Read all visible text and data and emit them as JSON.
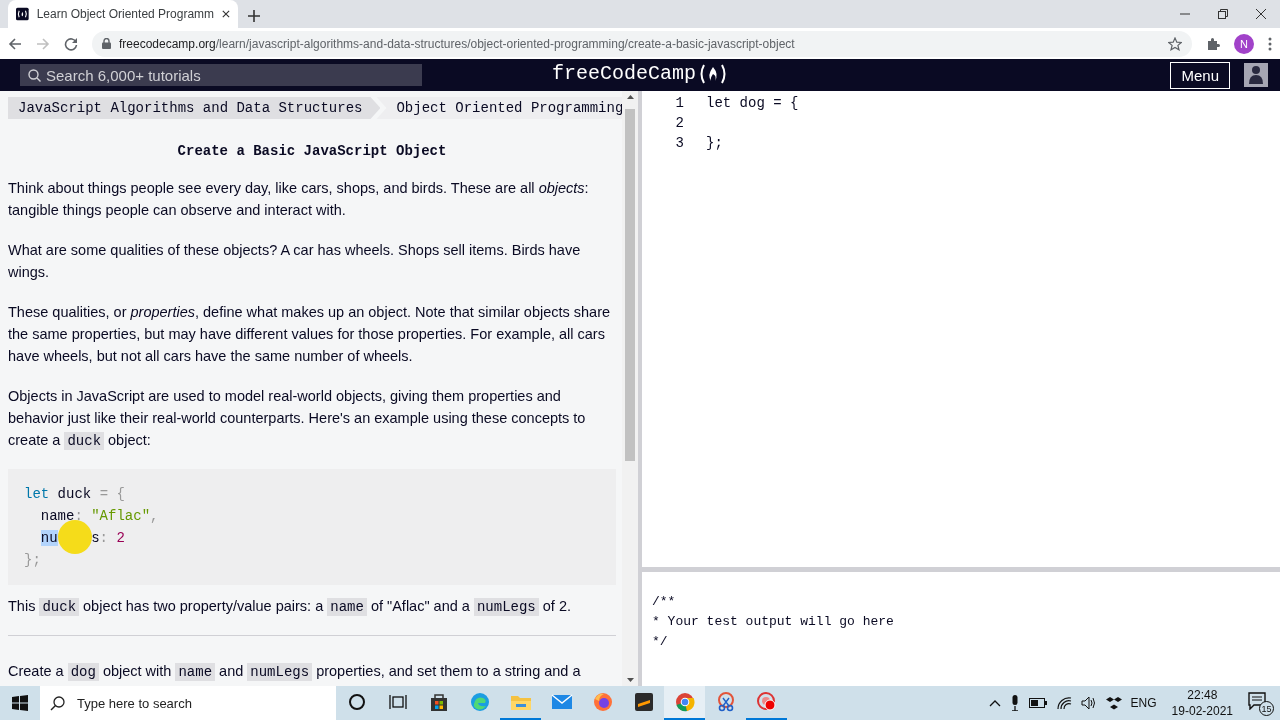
{
  "browser": {
    "tabs": [
      {
        "title": "Learn Object Oriented Programm",
        "selected": true
      }
    ],
    "url_host": "freecodecamp.org",
    "url_path": "/learn/javascript-algorithms-and-data-structures/object-oriented-programming/create-a-basic-javascript-object",
    "profile_initial": "N"
  },
  "nav": {
    "search_placeholder": "Search 6,000+ tutorials",
    "logo": "freeCodeCamp",
    "menu": "Menu"
  },
  "lesson": {
    "breadcrumbs": [
      "JavaScript Algorithms and Data Structures",
      "Object Oriented Programming"
    ],
    "title": "Create a Basic JavaScript Object",
    "intro": [
      [
        {
          "text": "Think about things people see every day, like cars, shops, and birds. These are all *objects*: tangible things people can observe and interact with."
        }
      ],
      [
        {
          "text": "What are some qualities of these objects? A car has wheels. Shops sell items. Birds have wings."
        }
      ],
      [
        {
          "text": "These qualities, or *properties*, define what makes up an object. Note that similar objects share the same properties, but may have different values for those properties. For example, all cars have wheels, but not all cars have the same number of wheels."
        }
      ],
      [
        {
          "text": "Objects in JavaScript are used to model real-world objects, giving them properties and behavior just like their real-world counterparts. Here's an example using these concepts to create a "
        },
        {
          "code": "duck"
        },
        {
          "text": " object:"
        }
      ]
    ],
    "example_code": [
      {
        "indented": false,
        "tokens": [
          {
            "t": "let",
            "kind": "keyword"
          },
          {
            "t": " duck ",
            "kind": "plain"
          },
          {
            "t": "= {",
            "kind": "punct"
          }
        ]
      },
      {
        "indented": true,
        "tokens": [
          {
            "t": "name",
            "kind": "plain",
            "selected": false
          },
          {
            "t": ": ",
            "kind": "punct"
          },
          {
            "t": "\"Aflac\"",
            "kind": "string"
          },
          {
            "t": ",",
            "kind": "punct"
          }
        ]
      },
      {
        "indented": true,
        "tokens": [
          {
            "t": "nu",
            "kind": "plain",
            "selected": true
          },
          {
            "kind": "cursor"
          },
          {
            "t": "s",
            "kind": "plain",
            "selected": false
          },
          {
            "t": ": ",
            "kind": "punct"
          },
          {
            "t": "2",
            "kind": "number"
          }
        ]
      },
      {
        "indented": false,
        "tokens": [
          {
            "t": "};",
            "kind": "punct"
          }
        ]
      }
    ],
    "after": [
      {
        "text": "This "
      },
      {
        "code": "duck"
      },
      {
        "text": " object has two property/value pairs: a "
      },
      {
        "code": "name"
      },
      {
        "text": " of \"Aflac\" and a "
      },
      {
        "code": "numLegs"
      },
      {
        "text": " of 2."
      }
    ],
    "instructions": [
      {
        "text": "Create a "
      },
      {
        "code": "dog"
      },
      {
        "text": " object with "
      },
      {
        "code": "name"
      },
      {
        "text": " and "
      },
      {
        "code": "numLegs"
      },
      {
        "text": " properties, and set them to a string and a"
      }
    ]
  },
  "editor": {
    "lines": [
      {
        "number": "1",
        "code": "let dog = {"
      },
      {
        "number": "2"
      },
      {
        "number": "3",
        "code": "};"
      }
    ],
    "output": [
      "/**",
      "* Your test output will go here",
      "*/"
    ]
  },
  "taskbar": {
    "search_placeholder": "Type here to search",
    "apps": [
      {
        "kind": "cortana",
        "running": false,
        "selected": false
      },
      {
        "kind": "taskview",
        "running": false,
        "selected": false
      },
      {
        "kind": "store",
        "running": false,
        "selected": false
      },
      {
        "kind": "edge",
        "running": false,
        "selected": false
      },
      {
        "kind": "explorer",
        "running": true,
        "selected": false
      },
      {
        "kind": "mail",
        "running": false,
        "selected": false
      },
      {
        "kind": "firefox",
        "running": false,
        "selected": false
      },
      {
        "kind": "sublime",
        "running": false,
        "selected": false
      },
      {
        "kind": "chrome",
        "running": true,
        "selected": true
      },
      {
        "kind": "snip",
        "running": false,
        "selected": false
      },
      {
        "kind": "recorder",
        "running": true,
        "selected": false
      }
    ],
    "language": "ENG",
    "time": "22:48",
    "date": "19-02-2021",
    "notifications": "15"
  }
}
